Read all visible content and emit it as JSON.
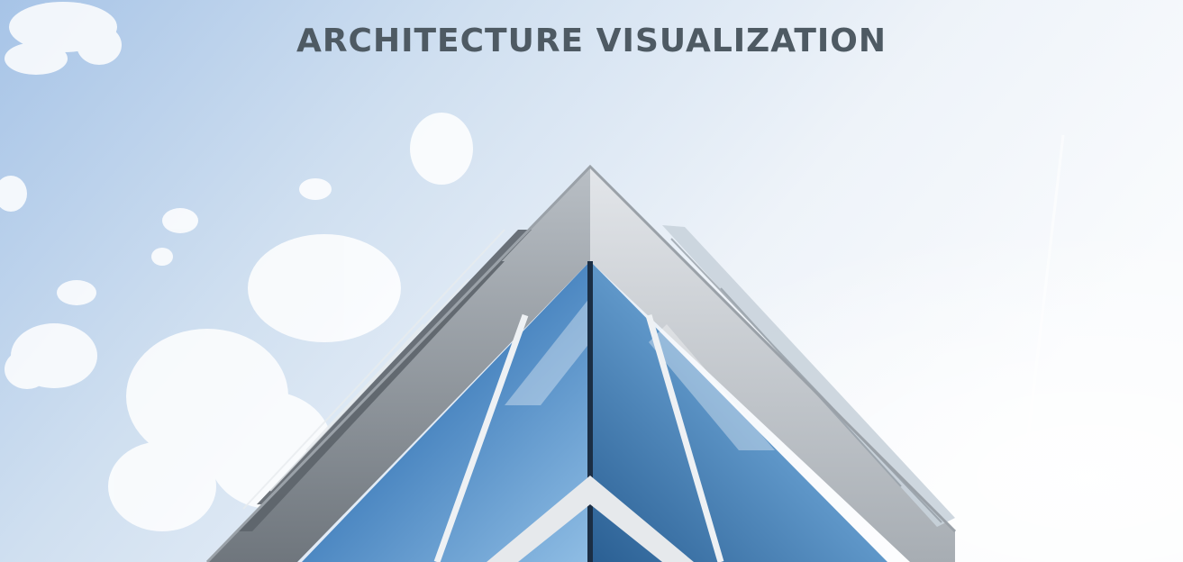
{
  "hero": {
    "title": "ARCHITECTURE VISUALIZATION",
    "photo_subject": "glass-building-corner-icon"
  },
  "colors": {
    "title": "#4e5a63",
    "sky_top": "#a9c6e8",
    "sky_bright": "#f4f7fb",
    "glass_dark": "#1f4f86",
    "glass_light": "#7fb2de",
    "frame": "#dfe3e8",
    "overhang": "#8a9096"
  }
}
